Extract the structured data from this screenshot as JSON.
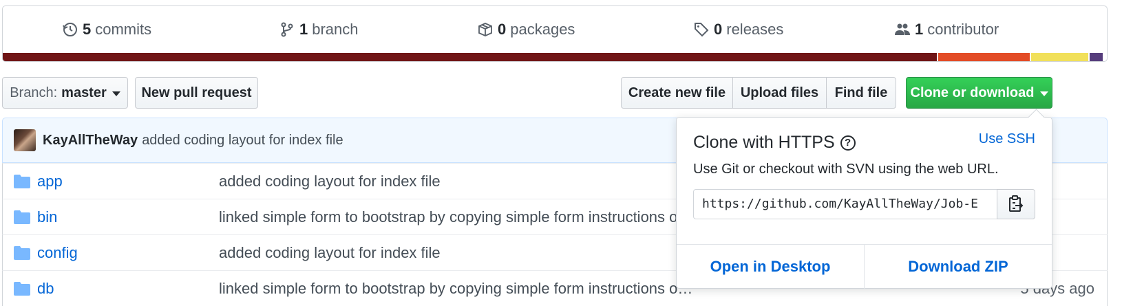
{
  "summary": {
    "commits": {
      "count": "5",
      "label": "commits",
      "icon": "history-icon"
    },
    "branches": {
      "count": "1",
      "label": "branch",
      "icon": "git-branch-icon"
    },
    "packages": {
      "count": "0",
      "label": "packages",
      "icon": "package-icon"
    },
    "releases": {
      "count": "0",
      "label": "releases",
      "icon": "tag-icon"
    },
    "contributors": {
      "count": "1",
      "label": "contributor",
      "icon": "people-icon"
    },
    "languages": [
      {
        "color": "#701516",
        "percent": 84.6
      },
      {
        "color": "#e34c26",
        "percent": 8.4
      },
      {
        "color": "#f1e05a",
        "percent": 5.3
      },
      {
        "color": "#563d7c",
        "percent": 1.3
      }
    ]
  },
  "toolbar": {
    "branch_prefix": "Branch:",
    "branch_name": "master",
    "new_pull_request": "New pull request",
    "create_new_file": "Create new file",
    "upload_files": "Upload files",
    "find_file": "Find file",
    "clone_or_download": "Clone or download"
  },
  "latest_commit": {
    "author": "KayAllTheWay",
    "message": "added coding layout for index file"
  },
  "files": [
    {
      "name": "app",
      "message": "added coding layout for index file",
      "age": ""
    },
    {
      "name": "bin",
      "message": "linked simple form to bootstrap by copying simple form instructions o…",
      "age": ""
    },
    {
      "name": "config",
      "message": "added coding layout for index file",
      "age": ""
    },
    {
      "name": "db",
      "message": "linked simple form to bootstrap by copying simple form instructions o…",
      "age": "5 days ago"
    }
  ],
  "clone_popover": {
    "title": "Clone with HTTPS",
    "help": "?",
    "use_ssh": "Use SSH",
    "description": "Use Git or checkout with SVN using the web URL.",
    "url": "https://github.com/KayAllTheWay/Job-E",
    "open_in_desktop": "Open in Desktop",
    "download_zip": "Download ZIP"
  },
  "colors": {
    "link": "#0366d6",
    "green_button": "#28a745",
    "folder": "#79b8ff"
  }
}
